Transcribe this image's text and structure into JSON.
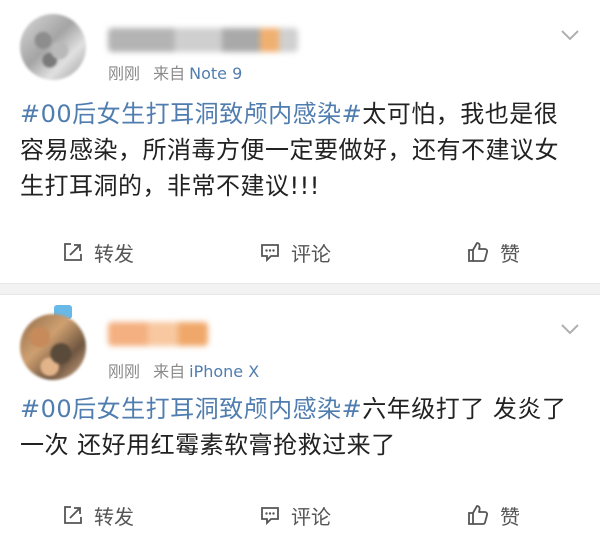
{
  "posts": [
    {
      "time": "刚刚",
      "source_prefix": "来自",
      "device": "Note 9",
      "hashtag": "#00后女生打耳洞致颅内感染#",
      "text": "太可怕，我也是很容易感染，所消毒方便一定要做好，还有不建议女生打耳洞的，非常不建议!!!",
      "actions": {
        "repost": "转发",
        "comment": "评论",
        "like": "赞"
      }
    },
    {
      "time": "刚刚",
      "source_prefix": "来自",
      "device": "iPhone X",
      "hashtag": "#00后女生打耳洞致颅内感染#",
      "text": "六年级打了 发炎了一次 还好用红霉素软膏抢救过来了",
      "actions": {
        "repost": "转发",
        "comment": "评论",
        "like": "赞"
      }
    }
  ],
  "icons": {
    "chevron": "chevron-down-icon",
    "repost": "repost-icon",
    "comment": "comment-icon",
    "like": "thumbs-up-icon"
  },
  "colors": {
    "link": "#507daf",
    "meta": "#8a8a8a",
    "text": "#222222",
    "separator": "#f2f2f2"
  }
}
